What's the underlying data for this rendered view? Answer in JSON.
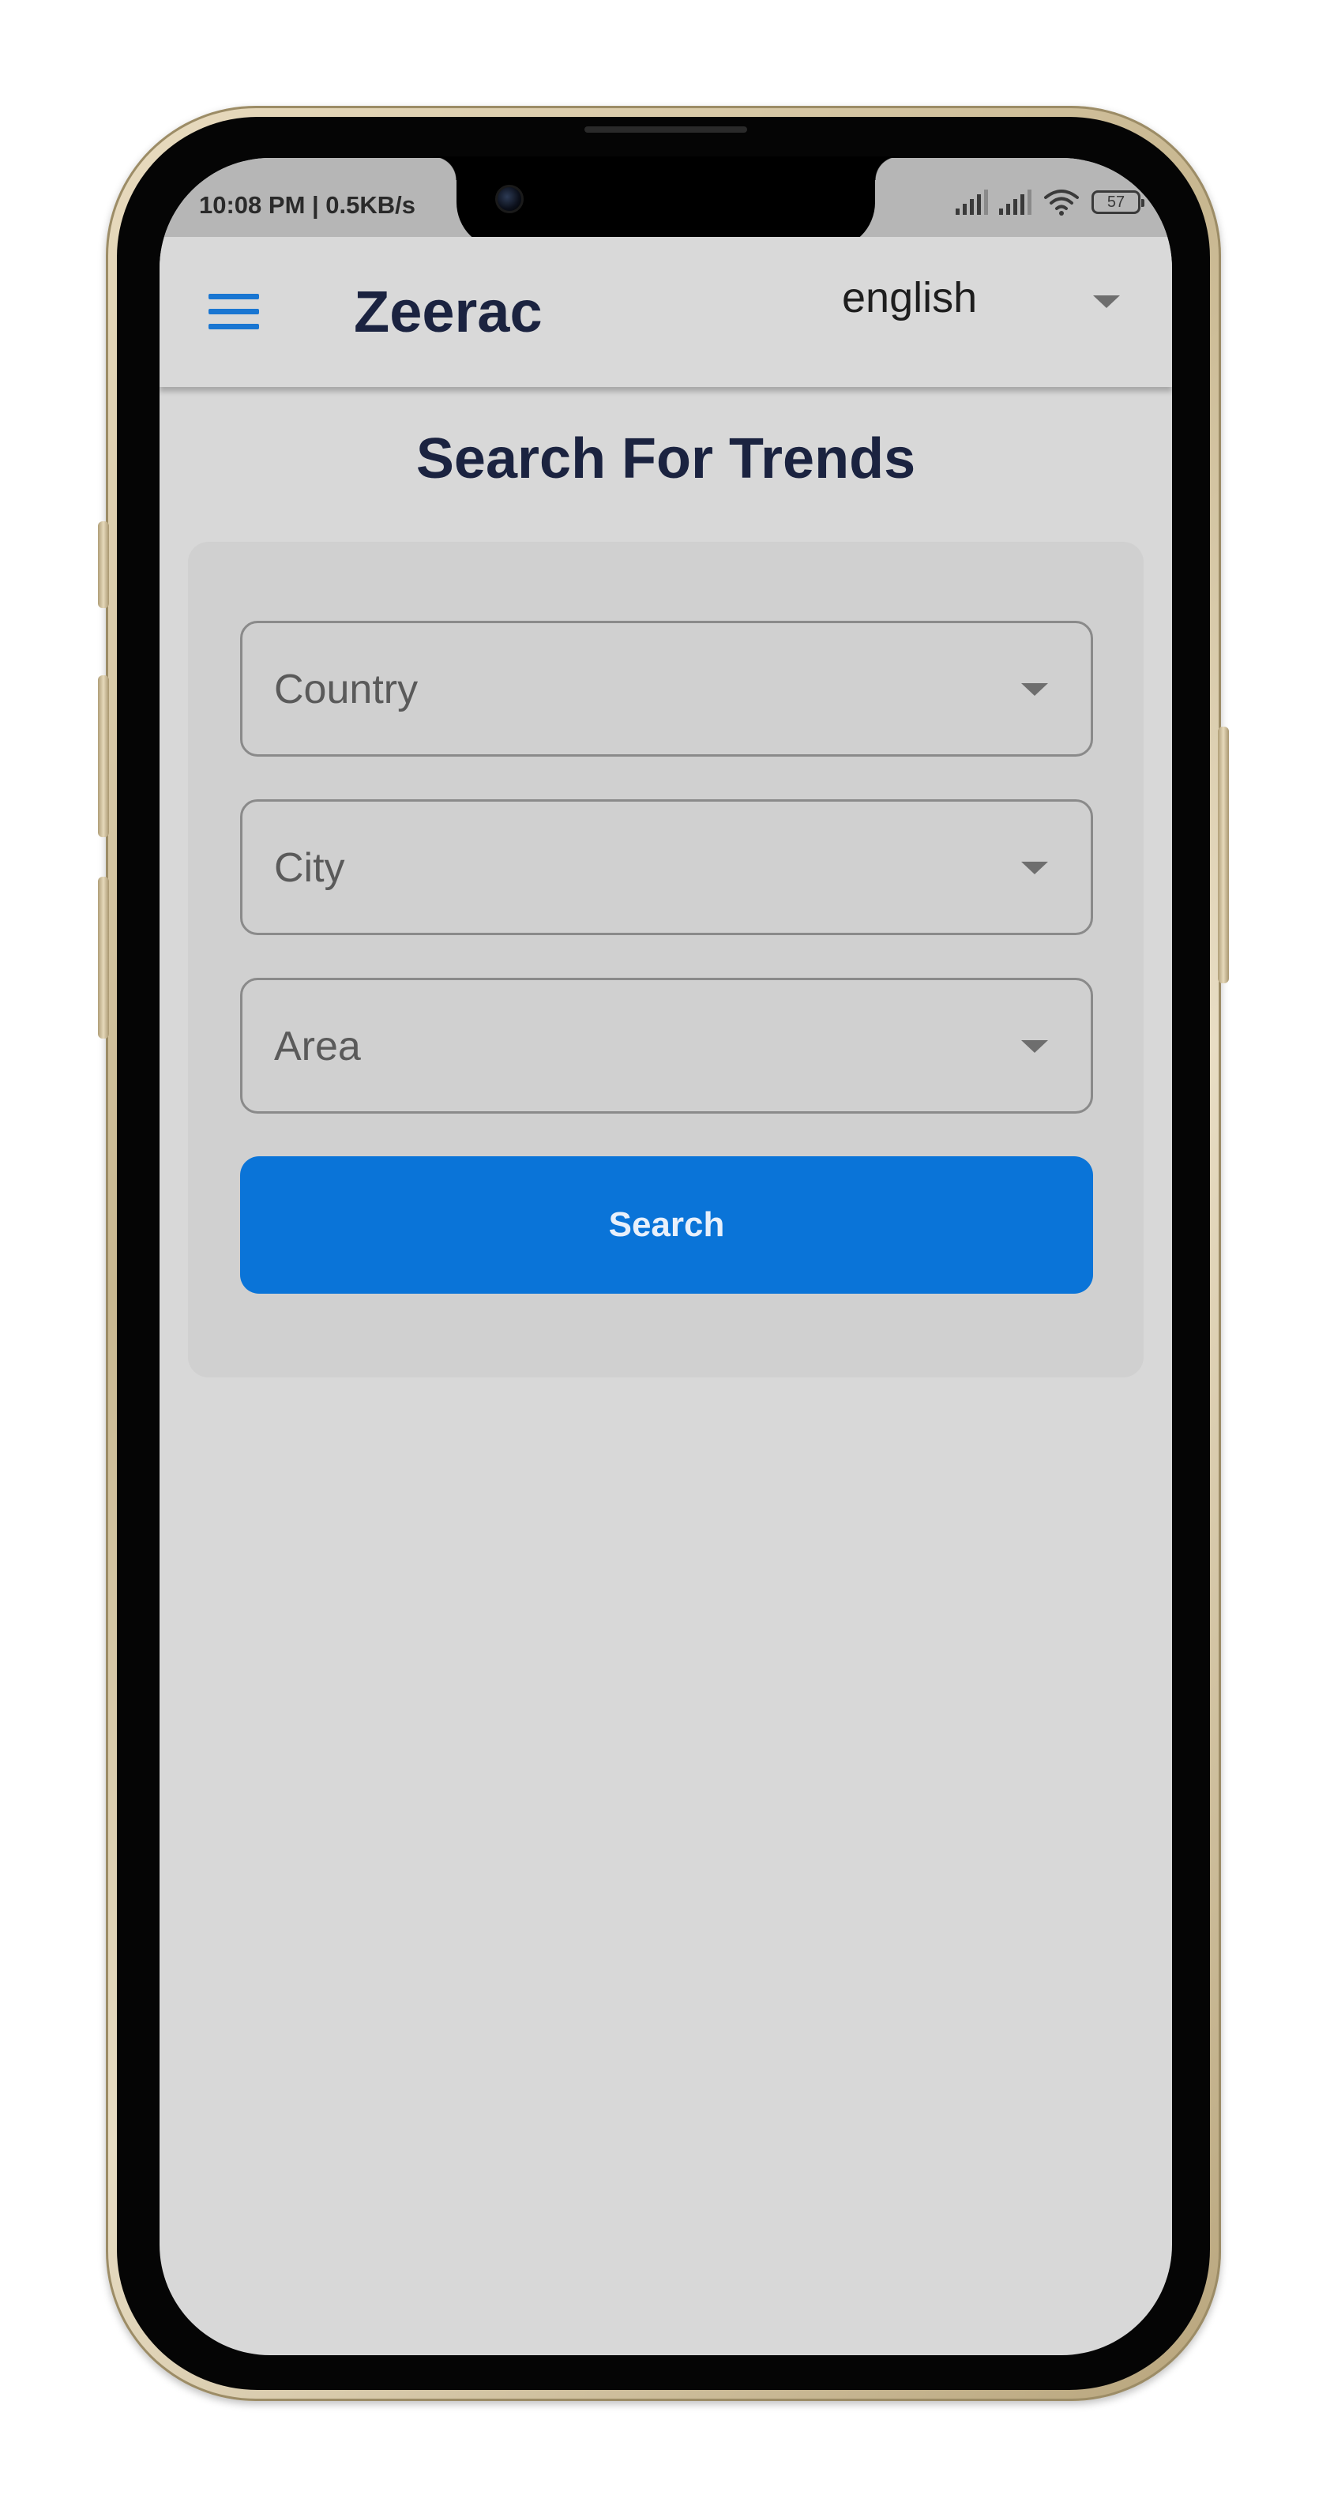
{
  "status_bar": {
    "time": "10:08 PM | 0.5KB/s",
    "battery": "57"
  },
  "app_bar": {
    "title": "Zeerac",
    "language": "english"
  },
  "main": {
    "title": "Search For Trends",
    "fields": {
      "country": "Country",
      "city": "City",
      "area": "Area"
    },
    "search_label": "Search"
  },
  "colors": {
    "accent": "#0a74d8",
    "title_text": "#1b2340",
    "screen_background": "#d8d8d8"
  },
  "icons": [
    "menu-icon",
    "chevron-down-icon",
    "signal-icon",
    "wifi-icon",
    "battery-icon"
  ]
}
